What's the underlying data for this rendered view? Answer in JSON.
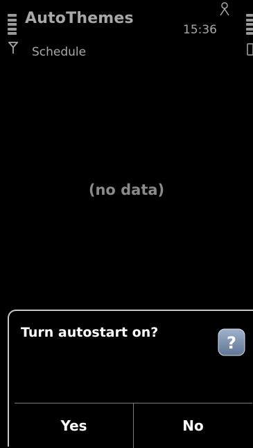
{
  "header": {
    "app_title": "AutoThemes",
    "clock": "15:36",
    "subtitle": "Schedule"
  },
  "icons": {
    "signal": "signal-strength-icon",
    "battery": "battery-level-icon",
    "antenna": "antenna-icon",
    "user": "user-icon",
    "phone": "phone-icon",
    "help": "help-question-icon"
  },
  "main": {
    "empty_text": "(no data)"
  },
  "dialog": {
    "message": "Turn autostart on?",
    "yes_label": "Yes",
    "no_label": "No"
  },
  "colors": {
    "background": "#000000",
    "text_dim": "#a8a8a8",
    "text_bright": "#ffffff",
    "help_icon": "#7f95b4"
  }
}
